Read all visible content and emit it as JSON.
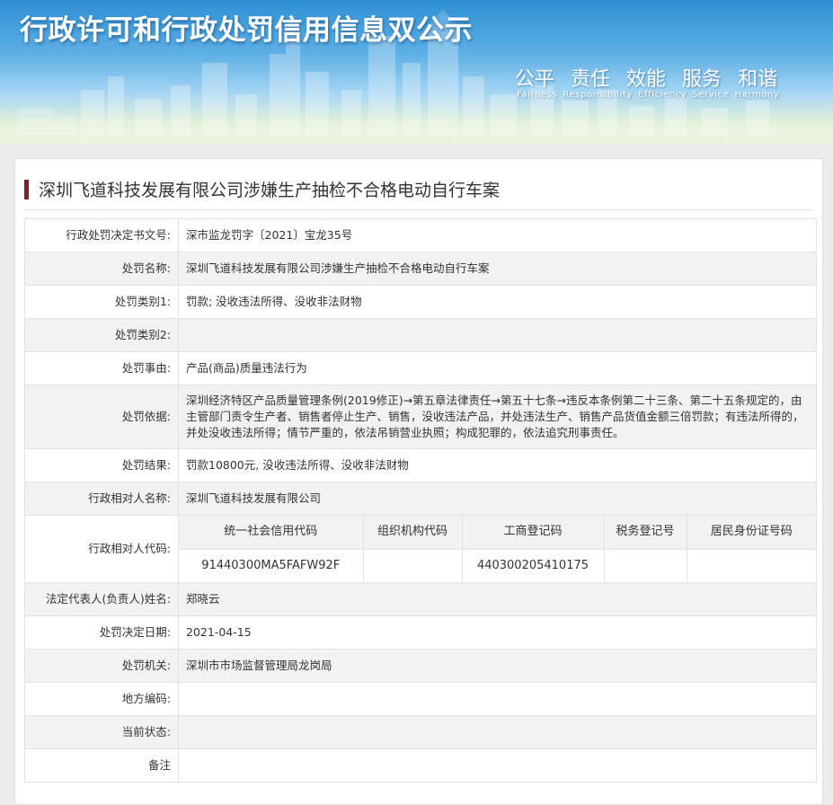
{
  "banner": {
    "title": "行政许可和行政处罚信用信息双公示",
    "slogan_cn": [
      "公平",
      "责任",
      "效能",
      "服务",
      "和谐"
    ],
    "slogan_en": [
      "Fairness",
      "Responsibility",
      "Efficiency",
      "Service",
      "Harmony"
    ]
  },
  "case": {
    "title": "深圳飞道科技发展有限公司涉嫌生产抽检不合格电动自行车案"
  },
  "details": {
    "decision_no": {
      "label": "行政处罚决定书文号:",
      "value": "深市监龙罚字〔2021〕宝龙35号"
    },
    "penalty_name": {
      "label": "处罚名称:",
      "value": "深圳飞道科技发展有限公司涉嫌生产抽检不合格电动自行车案"
    },
    "category1": {
      "label": "处罚类别1:",
      "value": "罚款; 没收违法所得、没收非法财物"
    },
    "category2": {
      "label": "处罚类别2:",
      "value": ""
    },
    "reason": {
      "label": "处罚事由:",
      "value": "产品(商品)质量违法行为"
    },
    "basis": {
      "label": "处罚依据:",
      "value": "深圳经济特区产品质量管理条例(2019修正)→第五章法律责任→第五十七条→违反本条例第二十三条、第二十五条规定的，由主管部门责令生产者、销售者停止生产、销售，没收违法产品，并处违法生产、销售产品货值金额三倍罚款；有违法所得的，并处没收违法所得；情节严重的，依法吊销营业执照；构成犯罪的，依法追究刑事责任。"
    },
    "result": {
      "label": "处罚结果:",
      "value": "罚款10800元, 没收违法所得、没收非法财物"
    },
    "party_name": {
      "label": "行政相对人名称:",
      "value": "深圳飞道科技发展有限公司"
    },
    "party_code": {
      "label": "行政相对人代码:",
      "headers": [
        "统一社会信用代码",
        "组织机构代码",
        "工商登记码",
        "税务登记号",
        "居民身份证号码"
      ],
      "values": [
        "91440300MA5FAFW92F",
        "",
        "440300205410175",
        "",
        ""
      ]
    },
    "legal_rep": {
      "label": "法定代表人(负责人)姓名:",
      "value": "郑晓云"
    },
    "decision_date": {
      "label": "处罚决定日期:",
      "value": "2021-04-15"
    },
    "authority": {
      "label": "处罚机关:",
      "value": "深圳市市场监督管理局龙岗局"
    },
    "local_code": {
      "label": "地方编码:",
      "value": ""
    },
    "status": {
      "label": "当前状态:",
      "value": ""
    },
    "remarks": {
      "label": "备注",
      "value": ""
    }
  },
  "colors": {
    "accent_bar": "#7d2222",
    "row_shade": "#f2f2f2",
    "border": "#e3e3e3"
  }
}
